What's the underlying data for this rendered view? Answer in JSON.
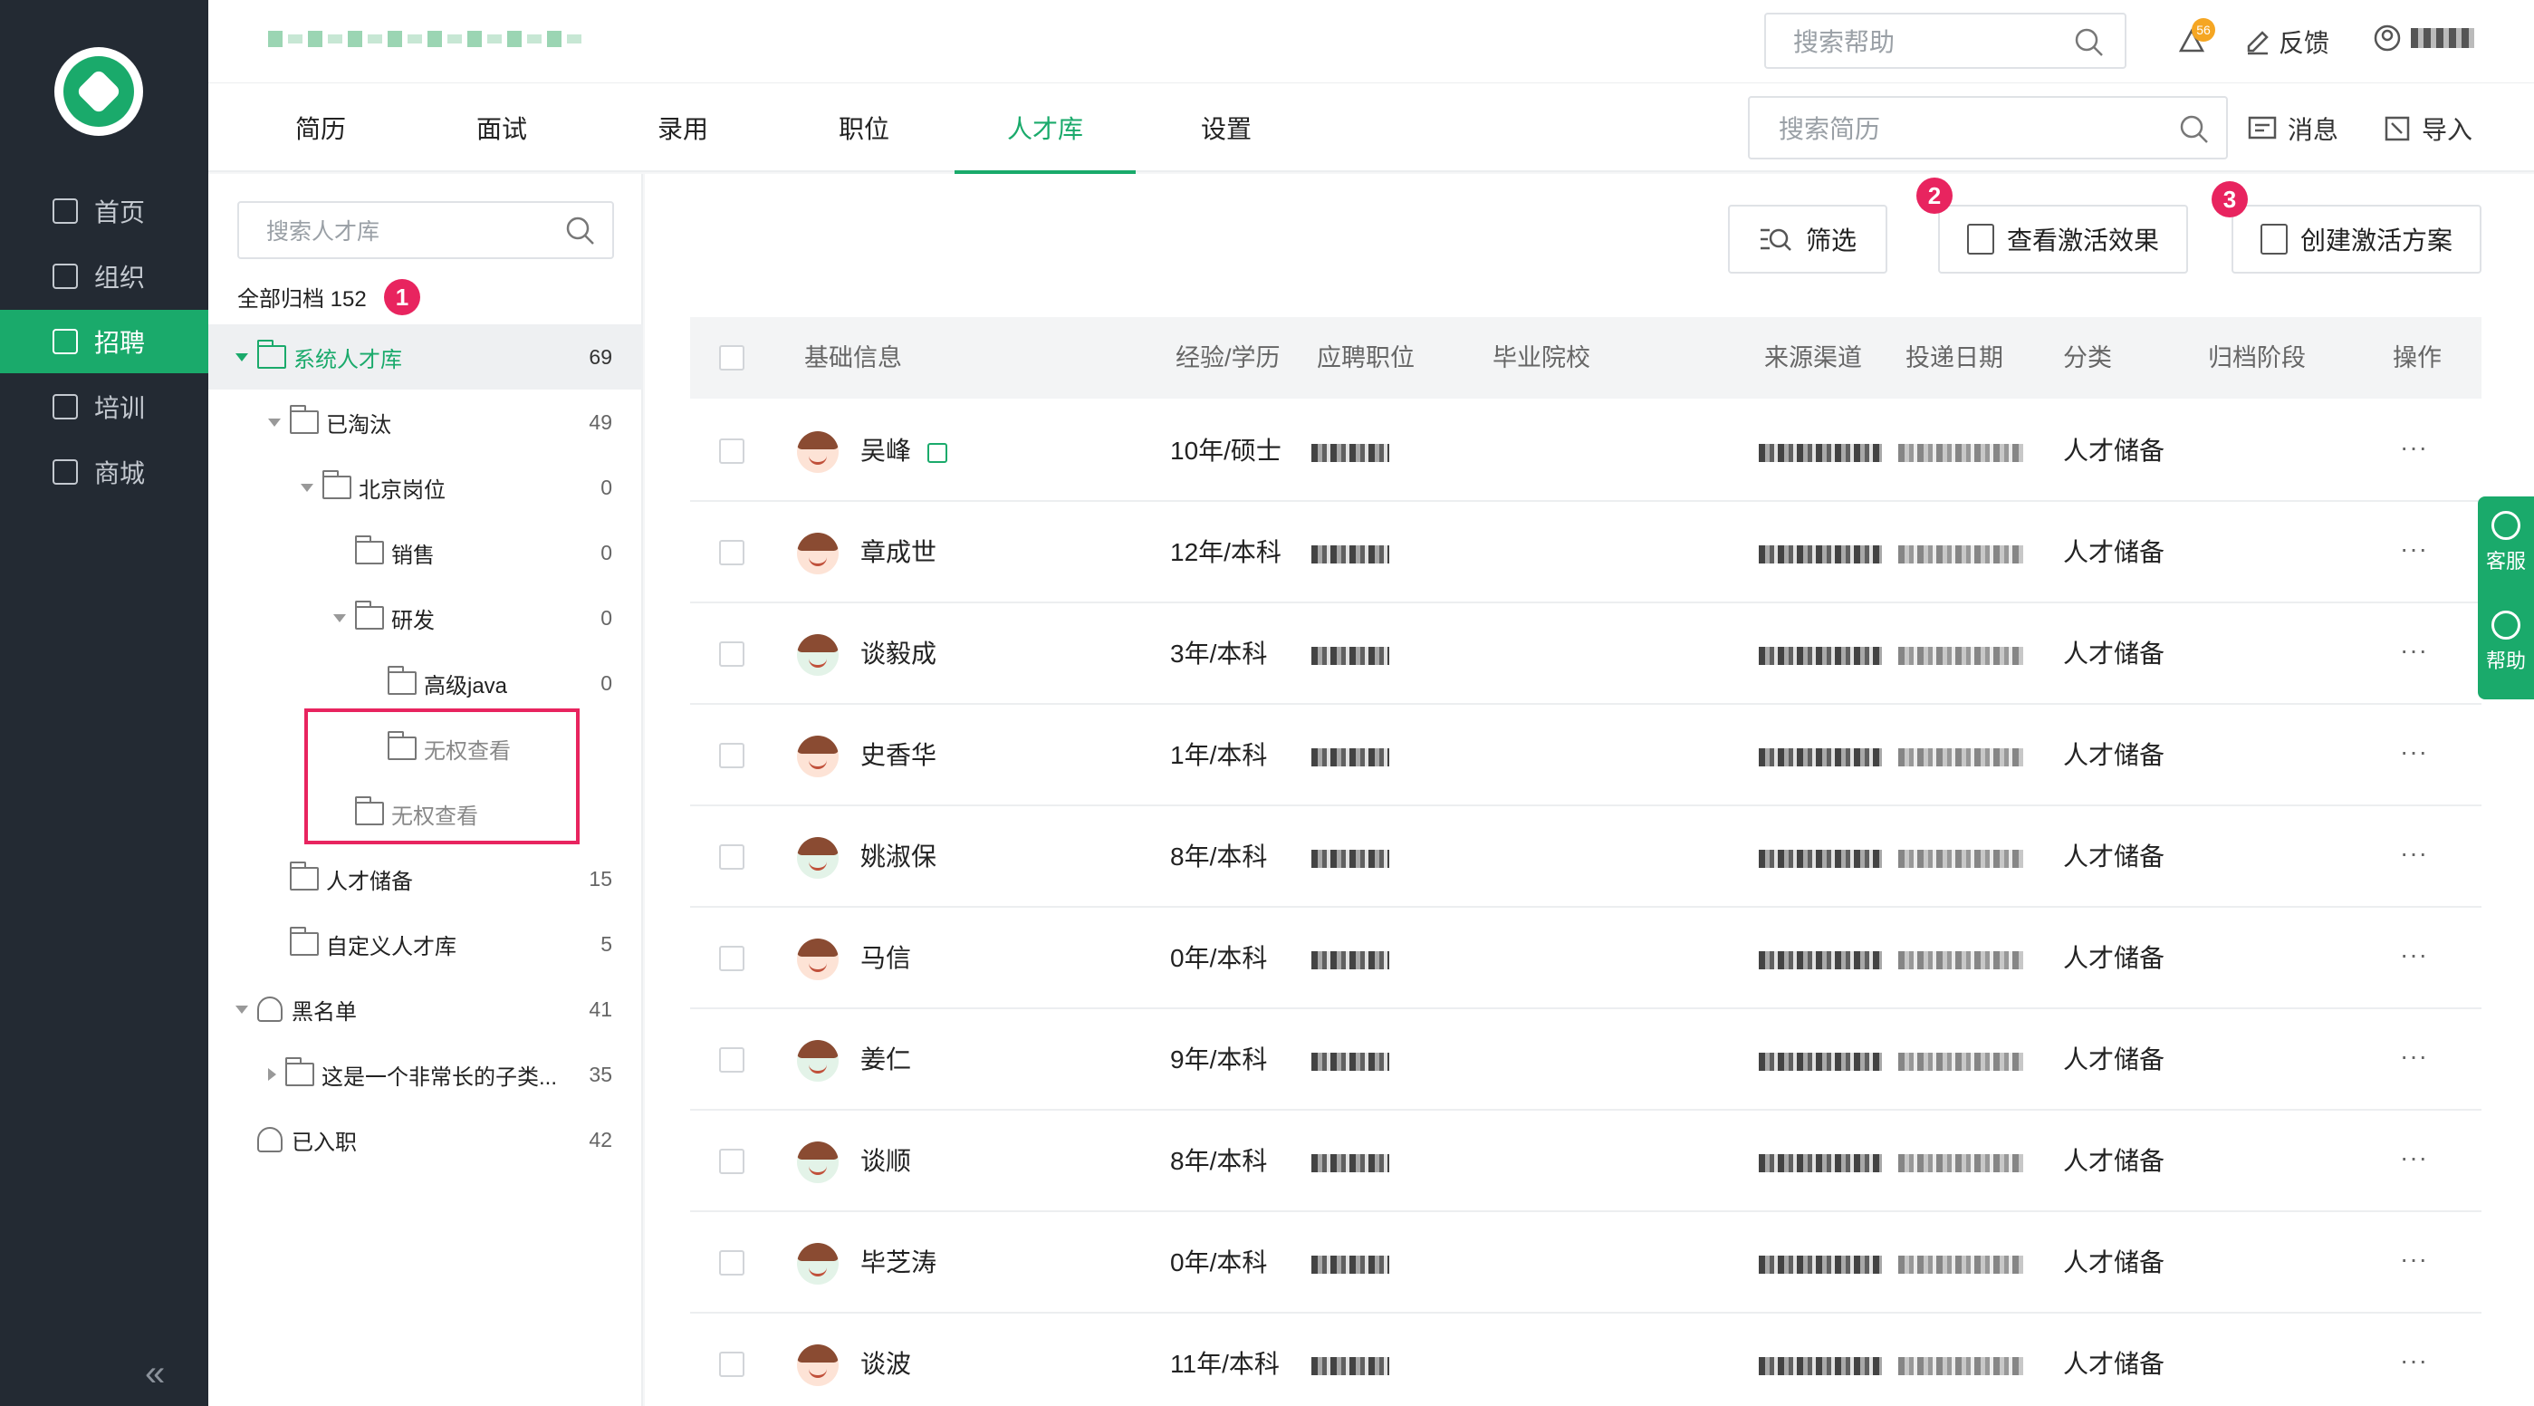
{
  "leftnav": {
    "items": [
      {
        "label": "首页",
        "icon": "home-icon"
      },
      {
        "label": "组织",
        "icon": "org-icon"
      },
      {
        "label": "招聘",
        "icon": "recruit-icon"
      },
      {
        "label": "培训",
        "icon": "training-icon"
      },
      {
        "label": "商城",
        "icon": "store-icon"
      }
    ],
    "active_index": 2,
    "collapse": "«"
  },
  "header": {
    "help_search_placeholder": "搜索帮助",
    "notification_badge": "56",
    "feedback": "反馈"
  },
  "tabs": [
    "简历",
    "面试",
    "录用",
    "职位",
    "人才库",
    "设置"
  ],
  "active_tab": 4,
  "tabbar": {
    "resume_search_placeholder": "搜索简历",
    "messages": "消息",
    "import": "导入"
  },
  "tree": {
    "search_placeholder": "搜索人才库",
    "archive_all": "全部归档 152",
    "nodes": [
      {
        "label": "系统人才库",
        "count": "69"
      },
      {
        "label": "已淘汰",
        "count": "49"
      },
      {
        "label": "北京岗位",
        "count": "0"
      },
      {
        "label": "销售",
        "count": "0"
      },
      {
        "label": "研发",
        "count": "0"
      },
      {
        "label": "高级java",
        "count": "0"
      },
      {
        "label": "无权查看",
        "count": ""
      },
      {
        "label": "无权查看",
        "count": ""
      },
      {
        "label": "人才储备",
        "count": "15"
      },
      {
        "label": "自定义人才库",
        "count": "5"
      },
      {
        "label": "黑名单",
        "count": "41"
      },
      {
        "label": "这是一个非常长的子类...",
        "count": "35"
      },
      {
        "label": "已入职",
        "count": "42"
      }
    ]
  },
  "markers": [
    "1",
    "2",
    "3"
  ],
  "toolbar": {
    "filter": "筛选",
    "view_activation": "查看激活效果",
    "create_activation": "创建激活方案"
  },
  "table": {
    "headers": [
      "基础信息",
      "经验/学历",
      "应聘职位",
      "毕业院校",
      "来源渠道",
      "投递日期",
      "分类",
      "归档阶段",
      "操作"
    ],
    "rows": [
      {
        "name": "吴峰",
        "exp": "10年/硕士",
        "category": "人才储备"
      },
      {
        "name": "章成世",
        "exp": "12年/本科",
        "category": "人才储备"
      },
      {
        "name": "谈毅成",
        "exp": "3年/本科",
        "category": "人才储备"
      },
      {
        "name": "史香华",
        "exp": "1年/本科",
        "category": "人才储备"
      },
      {
        "name": "姚淑保",
        "exp": "8年/本科",
        "category": "人才储备"
      },
      {
        "name": "马信",
        "exp": "0年/本科",
        "category": "人才储备"
      },
      {
        "name": "姜仁",
        "exp": "9年/本科",
        "category": "人才储备"
      },
      {
        "name": "谈顺",
        "exp": "8年/本科",
        "category": "人才储备"
      },
      {
        "name": "毕芝涛",
        "exp": "0年/本科",
        "category": "人才储备"
      },
      {
        "name": "谈波",
        "exp": "11年/本科",
        "category": "人才储备"
      }
    ],
    "more": "···"
  },
  "float": {
    "service": "客服",
    "help": "帮助"
  }
}
